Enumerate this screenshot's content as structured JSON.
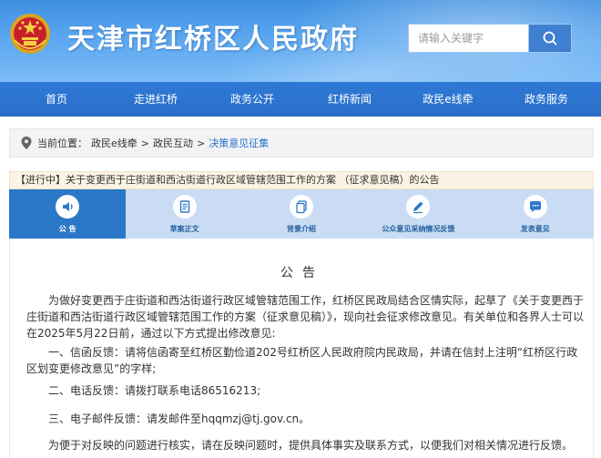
{
  "header": {
    "site_title": "天津市红桥区人民政府",
    "search_placeholder": "请输入关键字",
    "emblem_icon": "national-emblem-icon",
    "search_icon": "search-icon"
  },
  "nav": {
    "items": [
      {
        "label": "首页"
      },
      {
        "label": "走进红桥"
      },
      {
        "label": "政务公开"
      },
      {
        "label": "红桥新闻"
      },
      {
        "label": "政民e线牵"
      },
      {
        "label": "政务服务"
      }
    ]
  },
  "breadcrumb": {
    "prefix": "当前位置：",
    "items": [
      "政民e线牵",
      "政民互动",
      "决策意见征集"
    ],
    "separator": ">"
  },
  "notice": {
    "title": "【进行中】关于变更西于庄街道和西沽街道行政区域管辖范围工作的方案 （征求意见稿）的公告"
  },
  "tabs": [
    {
      "label": "公 告",
      "icon": "announcement-speaker-icon",
      "active": true
    },
    {
      "label": "草案正文",
      "icon": "document-icon",
      "active": false
    },
    {
      "label": "背景介绍",
      "icon": "file-copy-icon",
      "active": false
    },
    {
      "label": "公众意见采纳情况反馈",
      "icon": "feedback-pen-icon",
      "active": false
    },
    {
      "label": "发表意见",
      "icon": "chat-bubble-icon",
      "active": false
    }
  ],
  "content": {
    "heading": "公告",
    "p1": "为做好变更西于庄街道和西沽街道行政区域管辖范围工作，红桥区民政局结合区情实际，起草了《关于变更西于庄街道和西沽街道行政区域管辖范围工作的方案（征求意见稿）》，现向社会征求修改意见。有关单位和各界人士可以在2025年5月22日前，通过以下方式提出修改意见:",
    "p2": "一、信函反馈：请将信函寄至红桥区勤俭道202号红桥区人民政府院内民政局，并请在信封上注明“红桥区行政区划变更修改意见”的字样;",
    "p3": "二、电话反馈：请拨打联系电话86516213;",
    "p4": "三、电子邮件反馈：请发邮件至hqqmzj@tj.gov.cn。",
    "p5": "为便于对反映的问题进行核实，请在反映问题时，提供具体事实及联系方式，以便我们对相关情况进行反馈。"
  },
  "colors": {
    "banner_top": "#3f8fe0",
    "nav_bg": "#2a6fc8",
    "tab_active": "#2b78c8",
    "tab_bar": "#c9dcf3",
    "notice_bg": "#fbf3e3"
  }
}
